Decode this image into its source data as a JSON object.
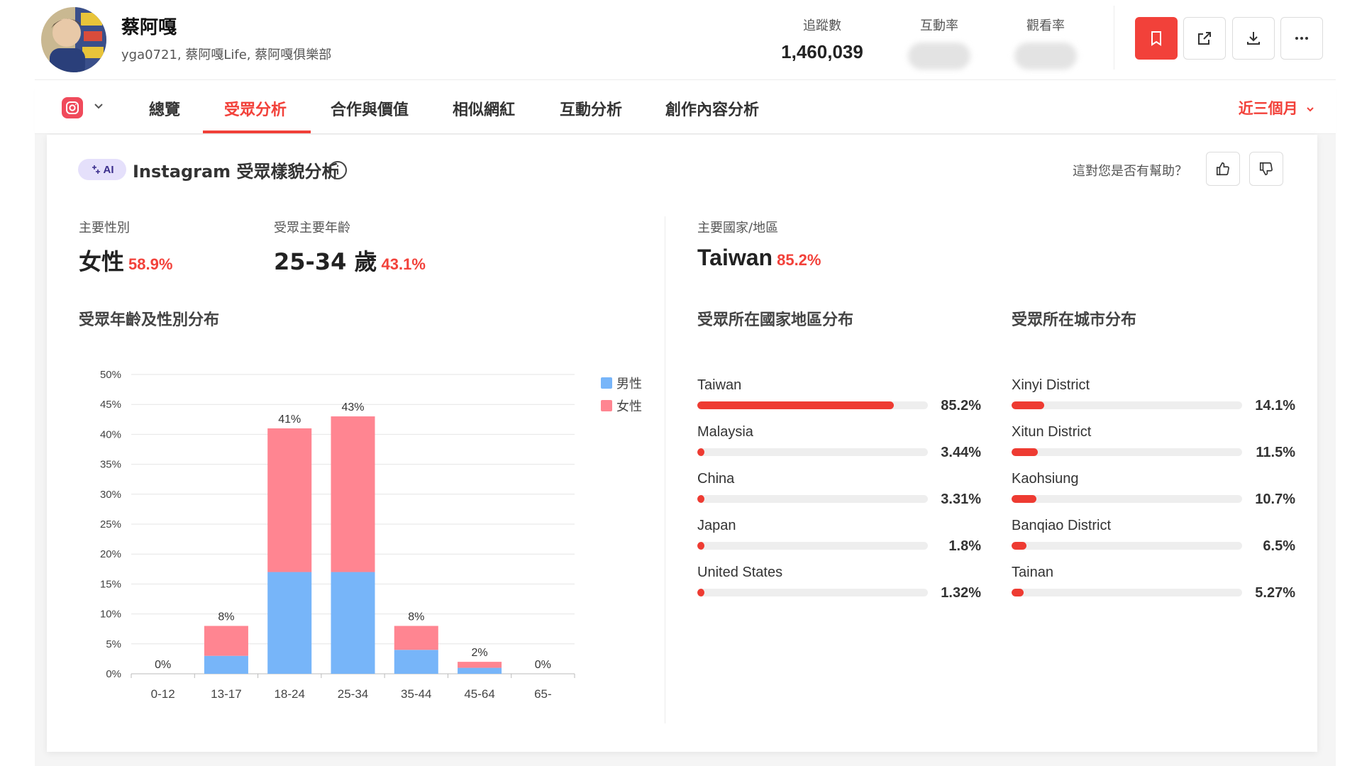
{
  "profile": {
    "name": "蔡阿嘎",
    "handle": "yga0721, 蔡阿嘎Life, 蔡阿嘎俱樂部"
  },
  "stats": [
    {
      "label": "追蹤數",
      "value": "1,460,039"
    },
    {
      "label": "互動率",
      "value": null
    },
    {
      "label": "觀看率",
      "value": null
    }
  ],
  "actions": [
    "bookmark-icon",
    "external-link-icon",
    "download-icon",
    "more-icon"
  ],
  "tabs": {
    "platform_icon": "instagram-icon",
    "items": [
      {
        "label": "總覽"
      },
      {
        "label": "受眾分析"
      },
      {
        "label": "合作與價值"
      },
      {
        "label": "相似網紅"
      },
      {
        "label": "互動分析"
      },
      {
        "label": "創作內容分析"
      }
    ],
    "active_index": 1,
    "period": "近三個月"
  },
  "section": {
    "ai_badge": "AI",
    "title": "Instagram 受眾樣貌分析",
    "helpful_question": "這對您是否有幫助？"
  },
  "kpis": {
    "gender": {
      "label": "主要性別",
      "value": "女性",
      "pct": "58.9%"
    },
    "age": {
      "label": "受眾主要年齡",
      "value": "25-34 歲",
      "pct": "43.1%"
    },
    "country": {
      "label": "主要國家/地區",
      "value": "Taiwan",
      "pct": "85.2%"
    }
  },
  "subtitles": {
    "age_gender": "受眾年齡及性別分布",
    "country": "受眾所在國家地區分布",
    "city": "受眾所在城市分布"
  },
  "colors": {
    "accent": "#f2413a",
    "male": "#77b5f9",
    "female": "#ff8591",
    "bar": "#ee3b32"
  },
  "chart_data": {
    "type": "bar",
    "stacked": true,
    "categories": [
      "0-12",
      "13-17",
      "18-24",
      "25-34",
      "35-44",
      "45-64",
      "65-"
    ],
    "series": [
      {
        "name": "男性",
        "values": [
          0,
          3,
          17,
          17,
          4,
          1,
          0
        ]
      },
      {
        "name": "女性",
        "values": [
          0,
          5,
          24,
          26,
          4,
          1,
          0
        ]
      }
    ],
    "totals_labels": [
      "0%",
      "8%",
      "41%",
      "43%",
      "8%",
      "2%",
      "0%"
    ],
    "totals": [
      0,
      8,
      41,
      43,
      8,
      2,
      0
    ],
    "yticks": [
      "0%",
      "5%",
      "10%",
      "15%",
      "20%",
      "25%",
      "30%",
      "35%",
      "40%",
      "45%",
      "50%"
    ],
    "ylim": [
      0,
      50
    ],
    "legend_position": "top-right",
    "grid": true
  },
  "countries": [
    {
      "name": "Taiwan",
      "value": "85.2%",
      "fraction": 0.852
    },
    {
      "name": "Malaysia",
      "value": "3.44%",
      "fraction": 0.0344
    },
    {
      "name": "China",
      "value": "3.31%",
      "fraction": 0.0331
    },
    {
      "name": "Japan",
      "value": "1.8%",
      "fraction": 0.018
    },
    {
      "name": "United States",
      "value": "1.32%",
      "fraction": 0.0132
    }
  ],
  "cities": [
    {
      "name": "Xinyi District",
      "value": "14.1%",
      "fraction": 0.141
    },
    {
      "name": "Xitun District",
      "value": "11.5%",
      "fraction": 0.115
    },
    {
      "name": "Kaohsiung",
      "value": "10.7%",
      "fraction": 0.107
    },
    {
      "name": "Banqiao District",
      "value": "6.5%",
      "fraction": 0.065
    },
    {
      "name": "Tainan",
      "value": "5.27%",
      "fraction": 0.0527
    }
  ]
}
